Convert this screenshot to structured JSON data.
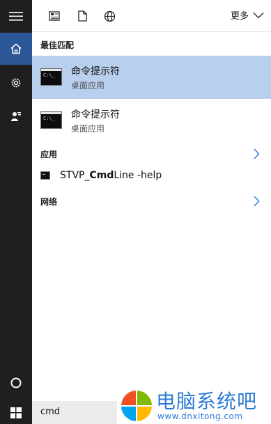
{
  "toolbar": {
    "more_label": "更多",
    "icons": [
      "document-grid-icon",
      "page-icon",
      "globe-icon"
    ]
  },
  "sections": {
    "best_match": "最佳匹配",
    "apps": "应用",
    "network": "网络"
  },
  "results": [
    {
      "title": "命令提示符",
      "subtitle": "桌面应用",
      "selected": true
    },
    {
      "title": "命令提示符",
      "subtitle": "桌面应用",
      "selected": false
    }
  ],
  "app_result": {
    "prefix": "STVP_",
    "bold": "Cmd",
    "suffix": "Line -help"
  },
  "search": {
    "value": "cmd"
  },
  "rail": [
    "menu-icon",
    "home-icon",
    "settings-icon",
    "contacts-icon",
    "circle-icon",
    "windows-icon"
  ],
  "colors": {
    "rail_bg": "#1f1f1f",
    "active_bg": "#2b5797",
    "selected_bg": "#b9cfee",
    "accent": "#2b7bd6"
  },
  "watermark": {
    "title": "电脑系统吧",
    "url": "www.dnxitong.com"
  }
}
